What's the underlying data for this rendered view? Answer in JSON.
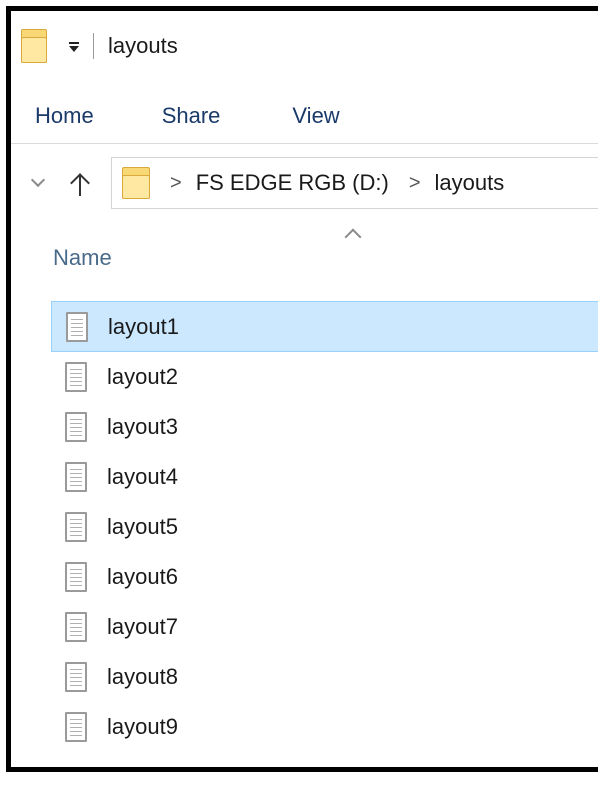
{
  "window": {
    "title": "layouts",
    "icons": {
      "folder": "folder-icon",
      "quick_access": "quick-access-dropdown-icon"
    }
  },
  "ribbon": {
    "tabs": [
      {
        "label": "Home"
      },
      {
        "label": "Share"
      },
      {
        "label": "View"
      }
    ]
  },
  "address": {
    "icons": {
      "recent": "chevron-down-icon",
      "up": "up-arrow-icon",
      "folder": "folder-icon"
    },
    "separator": ">",
    "breadcrumb": [
      {
        "label": "FS EDGE RGB (D:)"
      },
      {
        "label": "layouts"
      }
    ]
  },
  "columns": {
    "name": "Name",
    "sort_icon": "sort-ascending-icon"
  },
  "files": [
    {
      "name": "layout1",
      "selected": true
    },
    {
      "name": "layout2",
      "selected": false
    },
    {
      "name": "layout3",
      "selected": false
    },
    {
      "name": "layout4",
      "selected": false
    },
    {
      "name": "layout5",
      "selected": false
    },
    {
      "name": "layout6",
      "selected": false
    },
    {
      "name": "layout7",
      "selected": false
    },
    {
      "name": "layout8",
      "selected": false
    },
    {
      "name": "layout9",
      "selected": false
    }
  ],
  "colors": {
    "selection_bg": "#cce8ff",
    "selection_border": "#99d1ff",
    "folder": "#f8d775",
    "ribbon_text": "#1a3a6a"
  }
}
